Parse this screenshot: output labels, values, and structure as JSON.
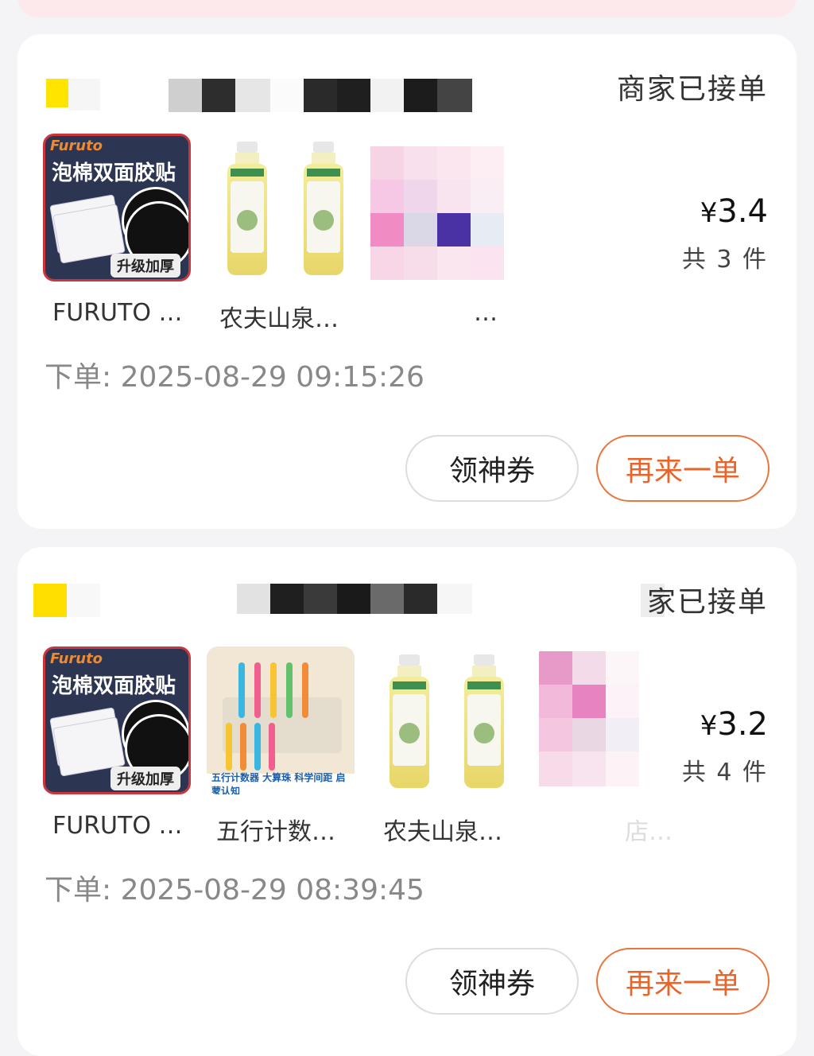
{
  "orders": [
    {
      "status": "商家已接单",
      "status_visible": "商家已接单",
      "items": [
        {
          "name": "FURUTO …",
          "image": "foam-double-sided-tape"
        },
        {
          "name": "农夫山泉…",
          "image": "bottled-tea-x2"
        },
        {
          "name": "…",
          "image": "pixelated"
        }
      ],
      "price_symbol": "¥",
      "price": "3.4",
      "count_text": "共 3 件",
      "order_time": "下单: 2025-08-29 09:15:26",
      "buttons": {
        "coupon": "领神券",
        "reorder": "再来一单"
      }
    },
    {
      "status": "家已接单",
      "items": [
        {
          "name": "FURUTO …",
          "image": "foam-double-sided-tape"
        },
        {
          "name": "五行计数…",
          "image": "abacus-counter"
        },
        {
          "name": "农夫山泉…",
          "image": "bottled-tea-x2"
        },
        {
          "name": "店…",
          "image": "pixelated"
        }
      ],
      "price_symbol": "¥",
      "price": "3.2",
      "count_text": "共 4 件",
      "order_time": "下单: 2025-08-29 08:39:45",
      "buttons": {
        "coupon": "领神券",
        "reorder": "再来一单"
      }
    }
  ],
  "product_art": {
    "adhesive_brand": "Furuto",
    "adhesive_headline": "泡棉双面胶贴",
    "adhesive_subline": "升级加厚",
    "abacus_banner": "五行计数器  大算珠  科学间距  启蒙认知"
  },
  "colors": {
    "accent": "#e8652a",
    "page_bg": "#f4f4f6",
    "card_bg": "#ffffff"
  }
}
